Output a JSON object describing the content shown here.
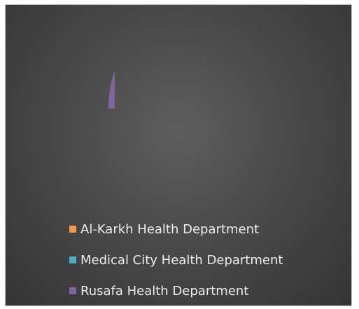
{
  "chart_data": {
    "type": "pie",
    "categories": [
      "Al-Karkh Health Department",
      "Medical City Health Department",
      "Rusafa Health Department"
    ],
    "values": [
      0,
      0,
      1
    ],
    "legend_position": "bottom",
    "colors": [
      "#f79646",
      "#4bacc6",
      "#8064a2"
    ]
  },
  "legend": [
    {
      "label": "Al-Karkh Health Department",
      "color": "#f79646"
    },
    {
      "label": "Medical City Health Department",
      "color": "#4bacc6"
    },
    {
      "label": "Rusafa Health Department",
      "color": "#8064a2"
    }
  ]
}
